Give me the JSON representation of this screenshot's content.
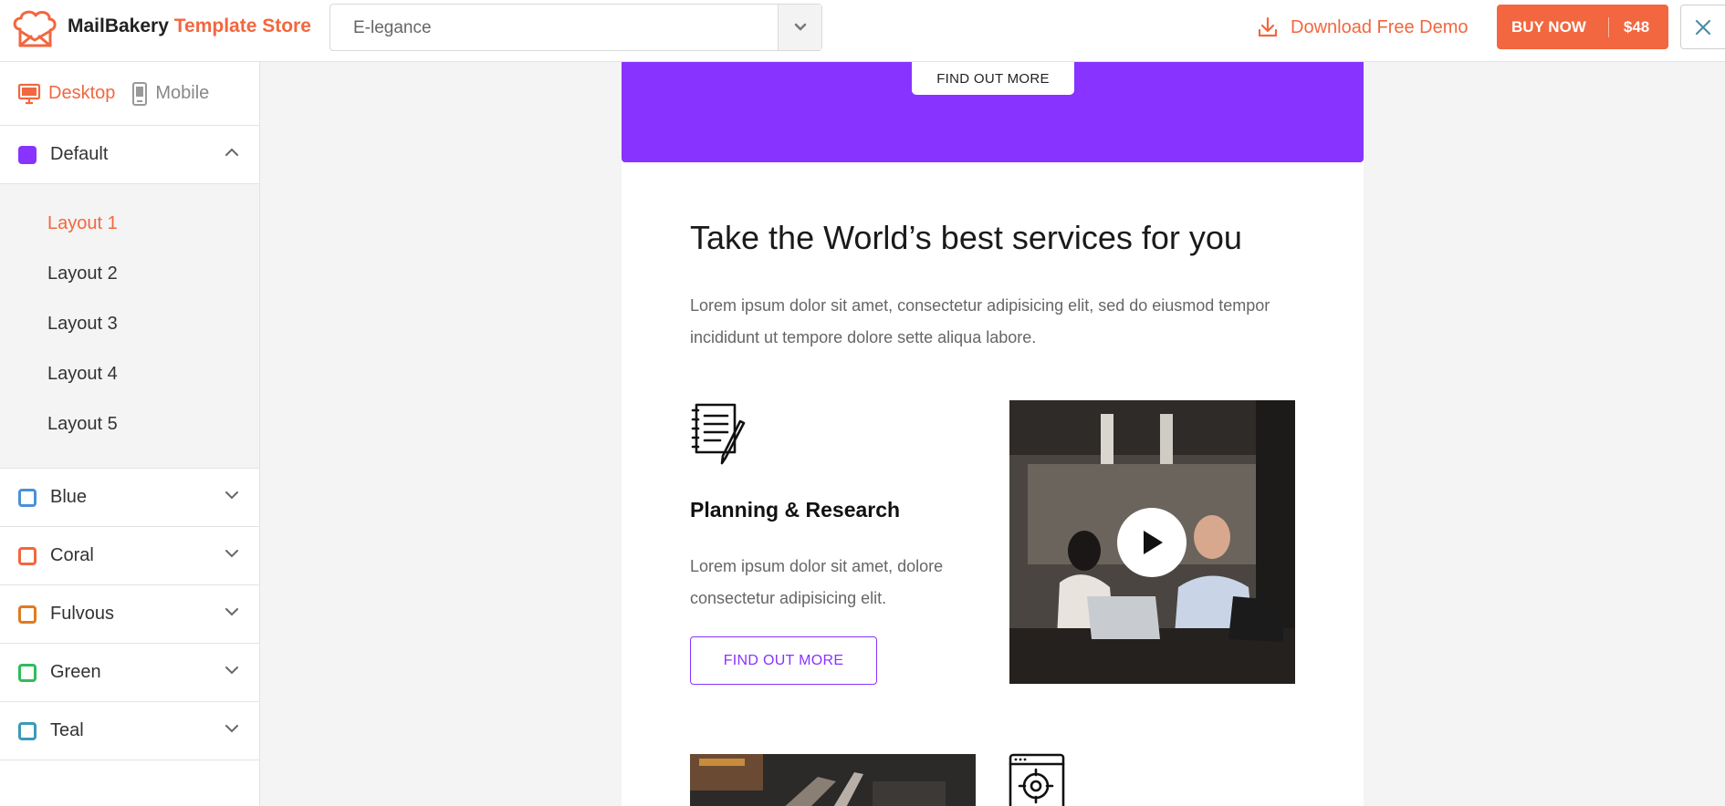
{
  "header": {
    "brand_name": "MailBakery",
    "brand_suffix": "Template Store",
    "template_select": {
      "value": "E-legance"
    },
    "download_label": "Download Free Demo",
    "buy_label": "BUY NOW",
    "price": "$48",
    "accent_color": "#f2673f"
  },
  "sidebar": {
    "devices": [
      {
        "label": "Desktop",
        "icon": "desktop-icon",
        "active": true
      },
      {
        "label": "Mobile",
        "icon": "mobile-icon",
        "active": false
      }
    ],
    "themes": [
      {
        "name": "Default",
        "color": "#8833ff",
        "expanded": true,
        "layouts": [
          "Layout 1",
          "Layout 2",
          "Layout 3",
          "Layout 4",
          "Layout 5"
        ],
        "active_layout": "Layout 1"
      },
      {
        "name": "Blue",
        "color": "#4a90d9",
        "expanded": false
      },
      {
        "name": "Coral",
        "color": "#f2673f",
        "expanded": false
      },
      {
        "name": "Fulvous",
        "color": "#e07b20",
        "expanded": false
      },
      {
        "name": "Green",
        "color": "#2ebd59",
        "expanded": false
      },
      {
        "name": "Teal",
        "color": "#3a9ab8",
        "expanded": false
      }
    ]
  },
  "preview": {
    "hero_button": "FIND OUT MORE",
    "hero_color": "#8833ff",
    "section_title": "Take the World’s best services for you",
    "section_desc": "Lorem ipsum dolor sit amet, consectetur adipisicing elit, sed do eiusmod tempor incididunt ut tempore dolore sette aliqua labore.",
    "feature": {
      "icon": "document-pen-icon",
      "title": "Planning & Research",
      "desc": "Lorem ipsum dolor sit amet, dolore consectetur adipisicing elit.",
      "button": "FIND OUT MORE"
    },
    "video_icon": "play-icon",
    "second_feature_icon": "browser-target-icon"
  }
}
